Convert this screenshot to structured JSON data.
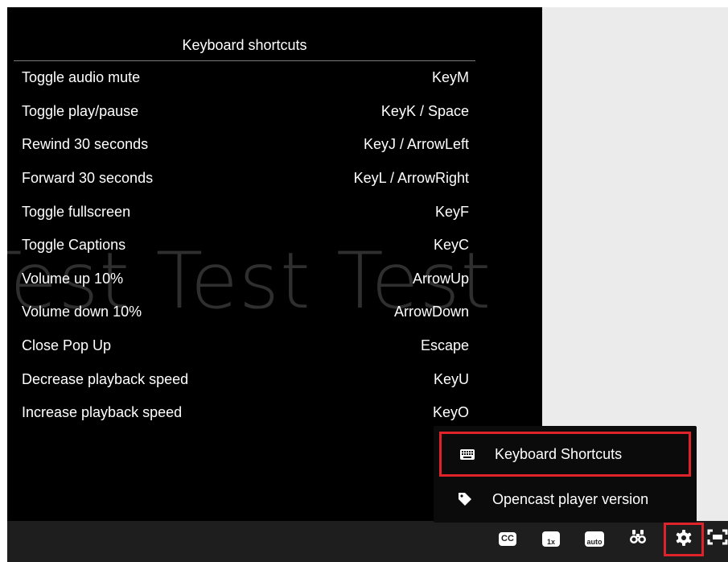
{
  "watermark_text": "Test Test Test",
  "shortcuts": {
    "title": "Keyboard shortcuts",
    "rows": [
      {
        "action": "Toggle audio mute",
        "keys": "KeyM"
      },
      {
        "action": "Toggle play/pause",
        "keys": "KeyK / Space"
      },
      {
        "action": "Rewind 30 seconds",
        "keys": "KeyJ / ArrowLeft"
      },
      {
        "action": "Forward 30 seconds",
        "keys": "KeyL / ArrowRight"
      },
      {
        "action": "Toggle fullscreen",
        "keys": "KeyF"
      },
      {
        "action": "Toggle Captions",
        "keys": "KeyC"
      },
      {
        "action": "Volume up 10%",
        "keys": "ArrowUp"
      },
      {
        "action": "Volume down 10%",
        "keys": "ArrowDown"
      },
      {
        "action": "Close Pop Up",
        "keys": "Escape"
      },
      {
        "action": "Decrease playback speed",
        "keys": "KeyU"
      },
      {
        "action": "Increase playback speed",
        "keys": "KeyO"
      }
    ]
  },
  "settings_menu": {
    "items": [
      {
        "label": "Keyboard Shortcuts",
        "icon": "keyboard-icon",
        "highlighted": true
      },
      {
        "label": "Opencast player version",
        "icon": "tag-icon",
        "highlighted": false
      }
    ]
  },
  "controls": {
    "captions_label": "CC",
    "playback_rate_label": "1x",
    "quality_label": "auto",
    "find_icon": "binoculars-icon",
    "settings_icon": "gear-icon",
    "settings_highlighted": true,
    "fullscreen_icon": "fullscreen-icon"
  },
  "colors": {
    "highlight": "#e0222b",
    "video_bg": "#000000",
    "player_bg": "#ebebeb"
  }
}
